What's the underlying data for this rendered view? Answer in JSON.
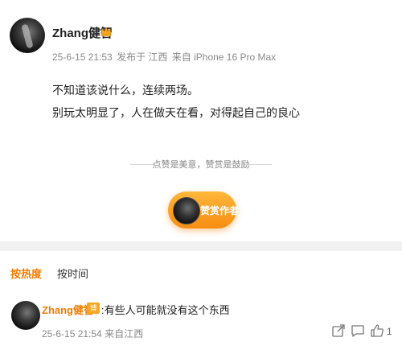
{
  "post": {
    "author": "Zhang健智",
    "time": "25-6-15 21:53",
    "from": "发布于 江西",
    "device": "来自 iPhone 16 Pro Max",
    "lines": [
      "不知道该说什么，连续两场。",
      "别玩太明显了，人在做天在看，对得起自己的良心"
    ],
    "praise_text": "点赞是美意，赞赏是鼓励",
    "reward_button": "赞赏作者"
  },
  "tabs": {
    "hot": "按热度",
    "time": "按时间"
  },
  "comment": {
    "author": "Zhang健智",
    "badge": "博主",
    "text": ":有些人可能就没有这个东西",
    "time": "25-6-15 21:54",
    "location": "来自江西",
    "like_count": "1"
  },
  "colors": {
    "accent": "#f07c00",
    "reward_gradient_top": "#ffb73a",
    "reward_gradient_bottom": "#f78d12"
  }
}
